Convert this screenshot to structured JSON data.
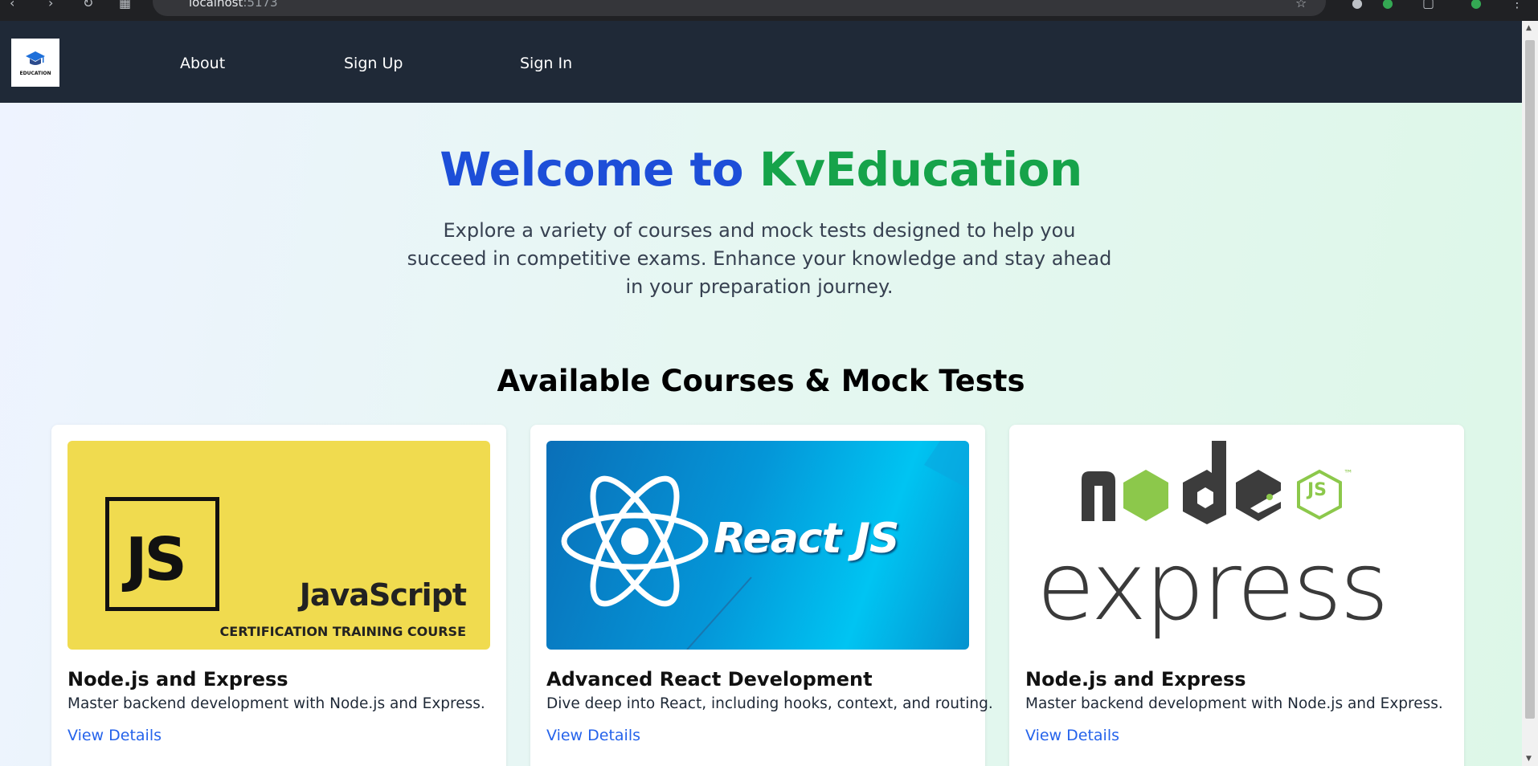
{
  "browser": {
    "url_host": "localhost",
    "url_port": ":5173"
  },
  "navbar": {
    "logo_text": "EDUCATION",
    "links": [
      {
        "label": "About"
      },
      {
        "label": "Sign Up"
      },
      {
        "label": "Sign In"
      }
    ]
  },
  "hero": {
    "title_part1": "Welcome to ",
    "title_part2": "KvEducation",
    "subtitle": "Explore a variety of courses and mock tests designed to help you succeed in competitive exams. Enhance your knowledge and stay ahead in your preparation journey."
  },
  "courses": {
    "section_title": "Available Courses & Mock Tests",
    "link_label": "View Details",
    "items": [
      {
        "title": "Node.js and Express",
        "description": "Master backend development with Node.js and Express.",
        "image": {
          "badge": "JS",
          "name": "JavaScript",
          "caption": "CERTIFICATION TRAINING COURSE"
        }
      },
      {
        "title": "Advanced React Development",
        "description": "Dive deep into React, including hooks, context, and routing.",
        "image": {
          "name": "React JS"
        }
      },
      {
        "title": "Node.js and Express",
        "description": "Master backend development with Node.js and Express.",
        "image": {
          "name": "express",
          "js_badge": "JS",
          "tm": "™"
        }
      }
    ]
  },
  "colors": {
    "navbar_bg": "#1f2937",
    "accent_blue": "#1d4ed8",
    "accent_green": "#16a34a",
    "link_blue": "#2563eb",
    "js_yellow": "#f0db4f",
    "react_blue": "#00a8e8",
    "node_green": "#8cc84b"
  }
}
